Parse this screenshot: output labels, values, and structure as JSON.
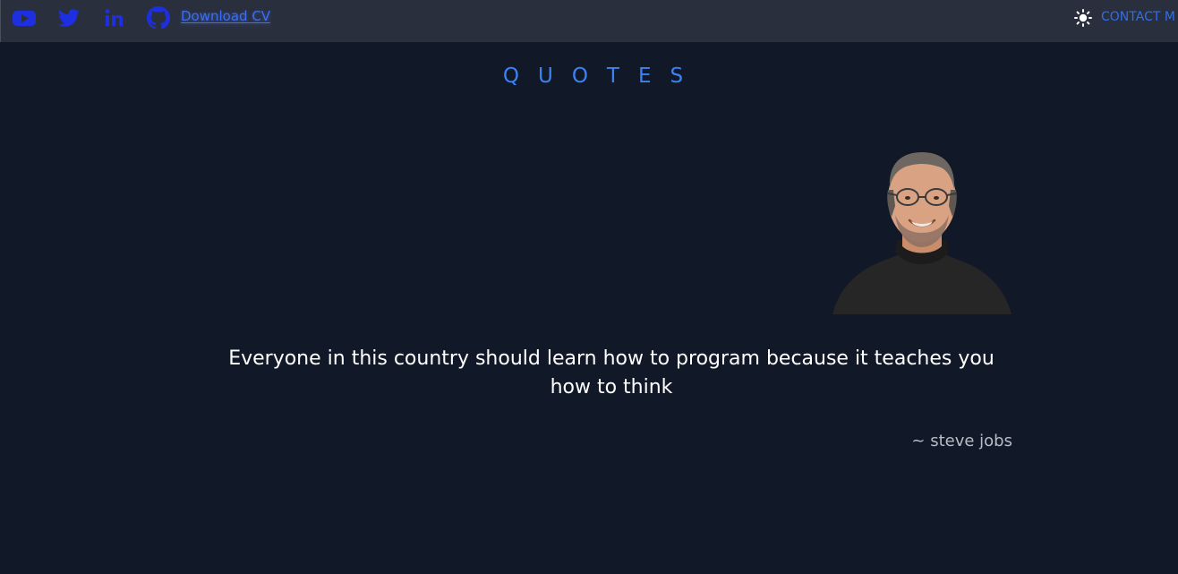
{
  "header": {
    "social_icons": [
      {
        "name": "youtube-icon",
        "color": "#1d2fe0"
      },
      {
        "name": "twitter-icon",
        "color": "#1d2fe0"
      },
      {
        "name": "linkedin-icon",
        "color": "#1d2fe0"
      },
      {
        "name": "github-icon",
        "color": "#1d2fe0"
      }
    ],
    "download_cv_label": "Download CV",
    "theme_icon": "sun-icon",
    "contact_label": "CONTACT M"
  },
  "main": {
    "section_title": "QUOTES",
    "quote": {
      "text": "Everyone in this country should learn how to program because it teaches you how to think",
      "author": "~ steve jobs"
    }
  },
  "colors": {
    "background": "#111827",
    "topbar": "#2a2f3d",
    "accent": "#3b82f6",
    "icon_blue": "#1d2fe0"
  }
}
